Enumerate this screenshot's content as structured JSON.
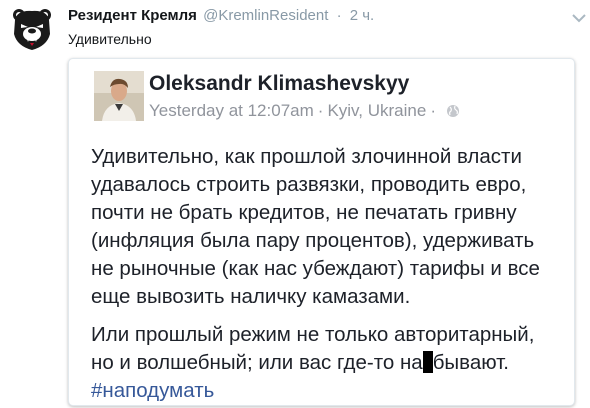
{
  "tweet": {
    "author_name": "Резидент Кремля",
    "author_handle": "@KremlinResident",
    "separator": "·",
    "timestamp": "2 ч.",
    "text": "Удивительно"
  },
  "embedded_post": {
    "author_name": "Oleksandr Klimashevskyy",
    "time": "Yesterday at 12:07am",
    "separator": "·",
    "location": "Kyiv, Ukraine",
    "separator_2": "·",
    "paragraph_1_line_1": "Удивительно, как прошлой злочинной власти",
    "paragraph_1_line_2": "удавалось строить развязки, проводить евро,",
    "paragraph_1_line_3": "почти не брать кредитов, не печатать гривну",
    "paragraph_1_line_4": "(инфляция была пару процентов), удерживать",
    "paragraph_1_line_5": "не рыночные (как нас убеждают) тарифы и все",
    "paragraph_1_line_6": "еще вывозить наличку камазами.",
    "paragraph_2_line_1": "Или прошлый режим не только авторитарный,",
    "paragraph_2_line_2_before": "но и волшебный; или вас где-то на",
    "paragraph_2_line_2_after": "бывают.",
    "hashtag": "#наподумать"
  },
  "colors": {
    "handle_gray": "#8899a6",
    "text_dark": "#14171a",
    "fb_meta_gray": "#90949c",
    "fb_link_blue": "#365899"
  },
  "icons": {
    "avatar": "grizzly-bear-avatar",
    "menu": "chevron-down-icon",
    "privacy": "globe-icon"
  }
}
